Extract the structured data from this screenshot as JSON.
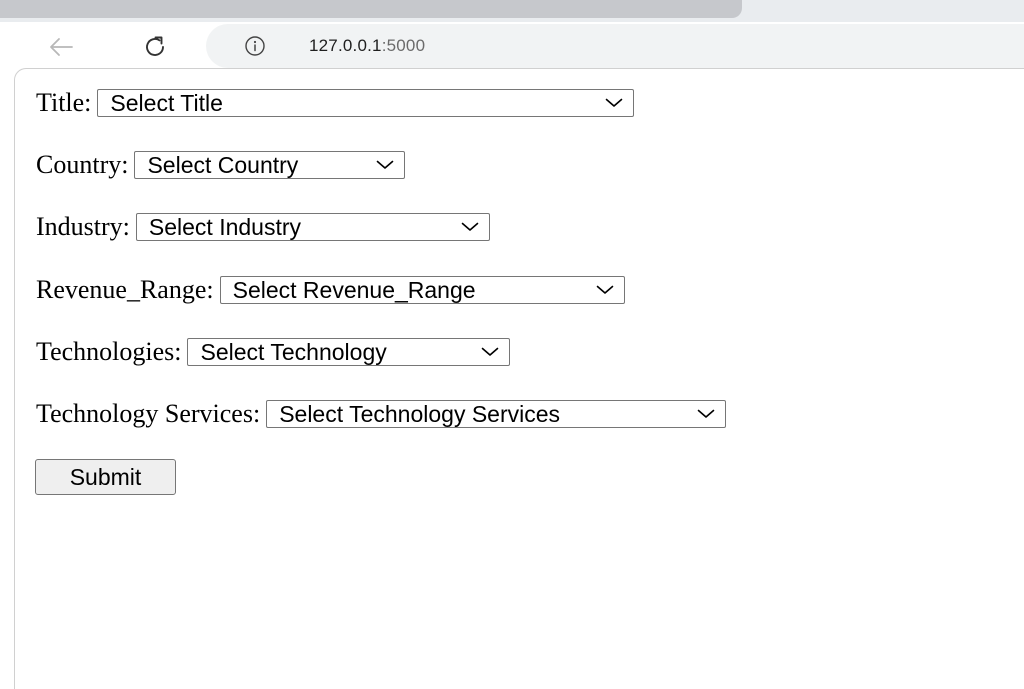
{
  "browser": {
    "url_host": "127.0.0.1",
    "url_port": ":5000",
    "icons": {
      "back": "back-arrow-icon",
      "reload": "reload-icon",
      "info": "site-info-icon"
    }
  },
  "form": {
    "fields": [
      {
        "label": "Title:",
        "selected": "Select Title"
      },
      {
        "label": "Country:",
        "selected": "Select Country"
      },
      {
        "label": "Industry:",
        "selected": "Select Industry"
      },
      {
        "label": "Revenue_Range:",
        "selected": "Select Revenue_Range"
      },
      {
        "label": "Technologies:",
        "selected": "Select Technology"
      },
      {
        "label": "Technology Services:",
        "selected": "Select Technology Services"
      }
    ],
    "submit_label": "Submit"
  },
  "colors": {
    "select_border": "#767676",
    "button_bg": "#efefef",
    "omnibox_bg": "#f1f3f4",
    "tab_active_bg": "#c6c8cc"
  }
}
